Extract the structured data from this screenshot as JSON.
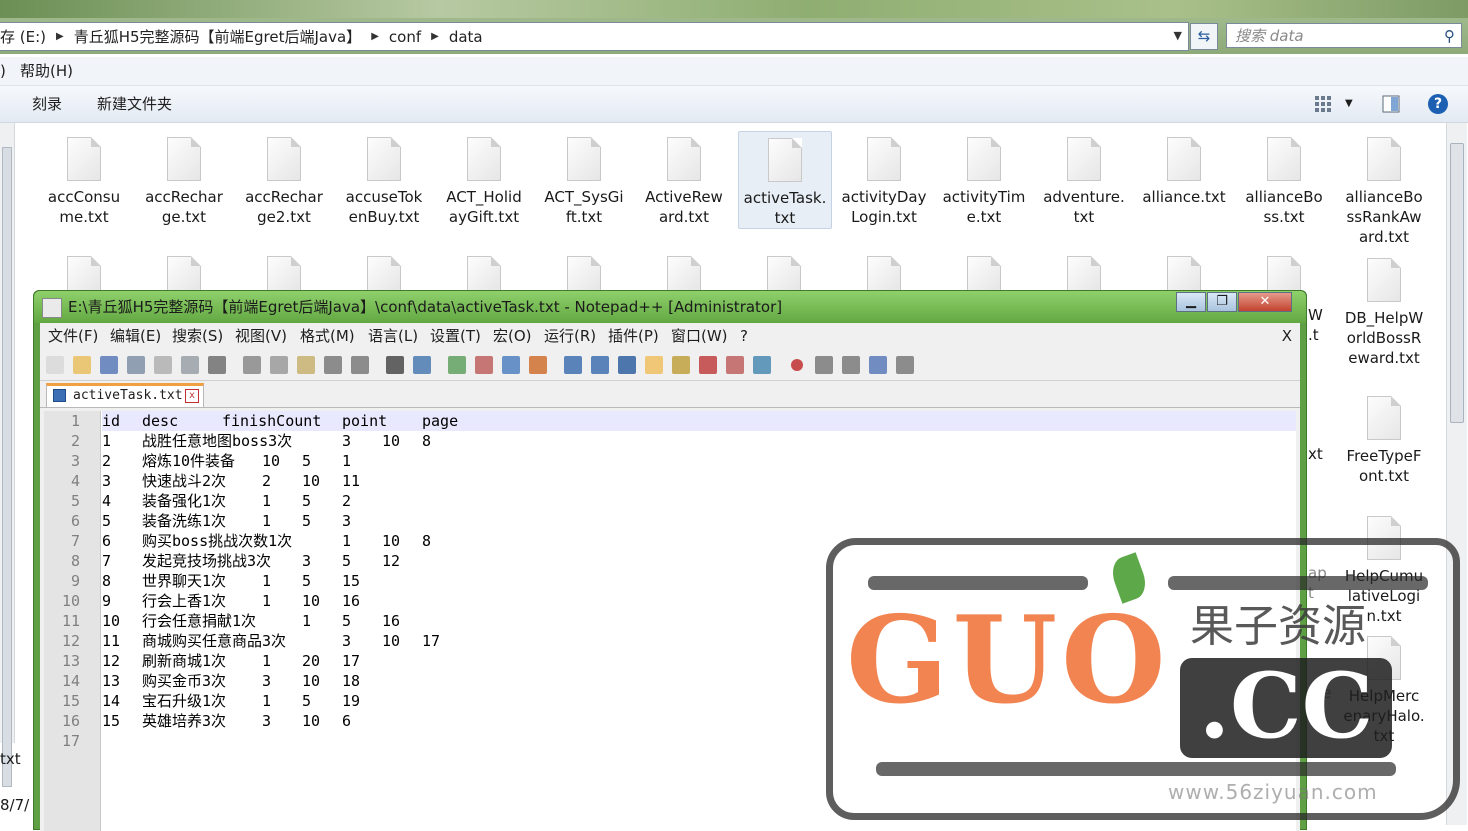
{
  "explorer": {
    "address_crumbs": [
      "存 (E:)",
      "青丘狐H5完整源码【前端Egret后端Java】",
      "conf",
      "data"
    ],
    "search_placeholder": "搜索 data",
    "menu_partial": ")",
    "menu_help": "帮助(H)",
    "cmd_burn": "刻录",
    "cmd_new_folder": "新建文件夹",
    "files_row1": [
      "accConsume.txt",
      "accRecharge.txt",
      "accRecharge2.txt",
      "accuseTokenBuy.txt",
      "ACT_HolidayGift.txt",
      "ACT_SysGift.txt",
      "ActiveReward.txt",
      "activeTask.txt",
      "activityDayLogin.txt",
      "activityTime.txt",
      "adventure.txt",
      "alliance.txt",
      "allianceBoss.txt",
      "allianceBossRankAward.txt"
    ],
    "files_row1_display": [
      [
        "accConsu",
        "me.txt"
      ],
      [
        "accRechar",
        "ge.txt"
      ],
      [
        "accRechar",
        "ge2.txt"
      ],
      [
        "accuseTok",
        "enBuy.txt"
      ],
      [
        "ACT_Holid",
        "ayGift.txt"
      ],
      [
        "ACT_SysGi",
        "ft.txt"
      ],
      [
        "ActiveRew",
        "ard.txt"
      ],
      [
        "activeTask.",
        "txt"
      ],
      [
        "activityDay",
        "Login.txt"
      ],
      [
        "activityTim",
        "e.txt"
      ],
      [
        "adventure.",
        "txt"
      ],
      [
        "alliance.txt"
      ],
      [
        "allianceBo",
        "ss.txt"
      ],
      [
        "allianceBo",
        "ssRankAw",
        "ard.txt"
      ]
    ],
    "file_db_helpworld": [
      "DB_HelpW",
      "orldBossR",
      "eward.txt"
    ],
    "file_freetype": [
      "FreeTypeF",
      "ont.txt"
    ],
    "file_helpcumu": [
      "HelpCumu",
      "lativeLogi",
      "n.txt"
    ],
    "file_helpmerc": [
      "HelpMerc",
      "enaryHalo.",
      "txt"
    ],
    "partial_w": "W",
    "partial_t": ".t",
    "partial_xt": "xt",
    "partial_ap": "ap",
    "partial_t2": "t",
    "partial_rce": "rce",
    "partial_left_txt": "txt",
    "partial_left_date": "8/7/"
  },
  "notepad": {
    "title": "E:\\青丘狐H5完整源码【前端Egret后端Java】\\conf\\data\\activeTask.txt - Notepad++ [Administrator]",
    "menu": [
      "文件(F)",
      "编辑(E)",
      "搜索(S)",
      "视图(V)",
      "格式(M)",
      "语言(L)",
      "设置(T)",
      "宏(O)",
      "运行(R)",
      "插件(P)",
      "窗口(W)",
      "?"
    ],
    "close_doc": "X",
    "tab_label": "activeTask.txt",
    "tab_close": "x",
    "line_numbers": [
      "1",
      "2",
      "3",
      "4",
      "5",
      "6",
      "7",
      "8",
      "9",
      "10",
      "11",
      "12",
      "13",
      "14",
      "15",
      "16",
      "17"
    ],
    "header": [
      "id",
      "desc",
      "finishCount",
      "point",
      "page"
    ],
    "rows": [
      [
        "1",
        "战胜任意地图boss3次",
        "3",
        "10",
        "8"
      ],
      [
        "2",
        "熔炼10件装备",
        "10",
        "5",
        "1"
      ],
      [
        "3",
        "快速战斗2次",
        "2",
        "10",
        "11"
      ],
      [
        "4",
        "装备强化1次",
        "1",
        "5",
        "2"
      ],
      [
        "5",
        "装备洗练1次",
        "1",
        "5",
        "3"
      ],
      [
        "6",
        "购买boss挑战次数1次",
        "1",
        "10",
        "8"
      ],
      [
        "7",
        "发起竞技场挑战3次",
        "3",
        "5",
        "12"
      ],
      [
        "8",
        "世界聊天1次",
        "1",
        "5",
        "15"
      ],
      [
        "9",
        "行会上香1次",
        "1",
        "10",
        "16"
      ],
      [
        "10",
        "行会任意捐献1次",
        "1",
        "5",
        "16"
      ],
      [
        "11",
        "商城购买任意商品3次",
        "3",
        "10",
        "17"
      ],
      [
        "12",
        "刷新商城1次",
        "1",
        "20",
        "17"
      ],
      [
        "13",
        "购买金币3次",
        "3",
        "10",
        "18"
      ],
      [
        "14",
        "宝石升级1次",
        "1",
        "5",
        "19"
      ],
      [
        "15",
        "英雄培养3次",
        "3",
        "10",
        "6"
      ]
    ]
  },
  "watermark": {
    "brand": "GUO",
    "cc": ".CC",
    "cn": "果子资源",
    "site": "www.56ziyuan.com"
  },
  "colors": {
    "npp_frame": "#5fa044",
    "watermark_orange": "#f06e32",
    "help_blue": "#1d5fb3"
  }
}
